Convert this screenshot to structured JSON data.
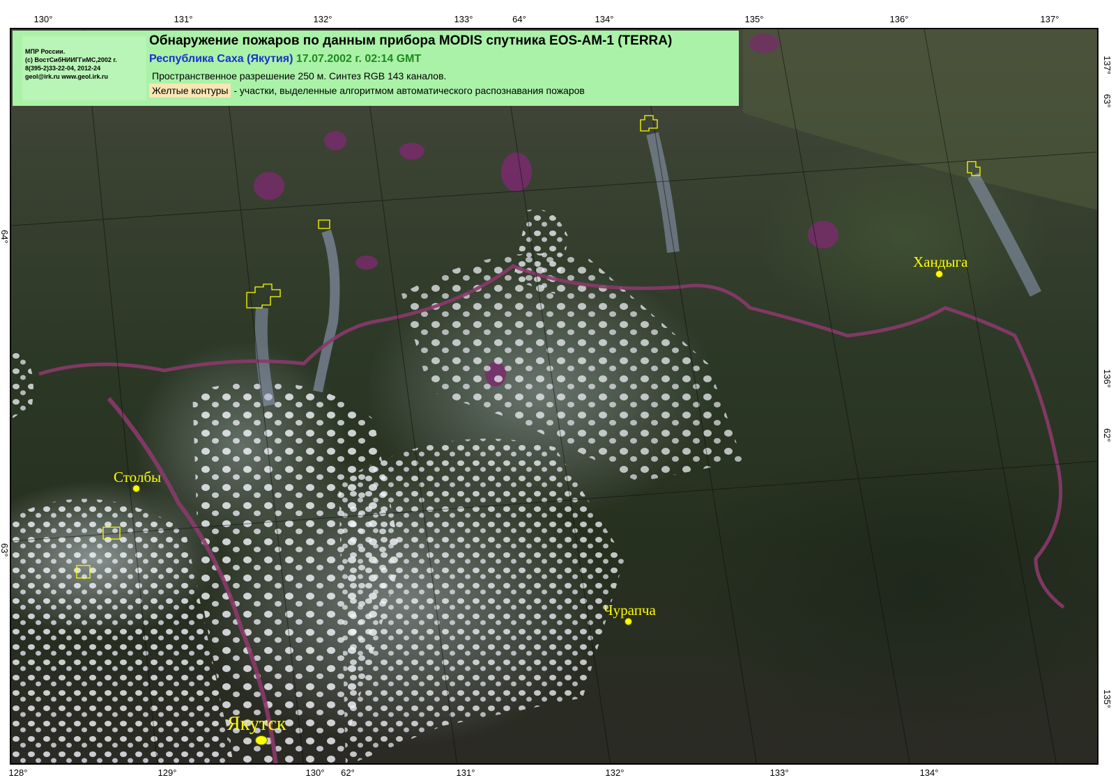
{
  "header": {
    "title": "Обнаружение пожаров по данным прибора MODIS спутника EOS-AM-1 (TERRA)",
    "region": "Республика Саха (Якутия)",
    "datetime": "17.07.2002 г. 02:14 GMT",
    "resolution": "Пространственное разрешение 250 м. Синтез RGB 143 каналов.",
    "legend_swatch_label": "Желтые контуры",
    "legend_text": " - участки, выделенные алгоритмом автоматического распознавания пожаров"
  },
  "credits": [
    "МПР России.",
    "(с) ВостСибНИИГГиМС,2002 г.",
    "8(395-2)33-22-04, 2012-24",
    "geol@irk.ru  www.geol.irk.ru"
  ],
  "ticks": {
    "top": [
      "130°",
      "131°",
      "132°",
      "133°",
      "64°",
      "134°",
      "135°",
      "136°",
      "137°"
    ],
    "bottom": [
      "128°",
      "129°",
      "130°",
      "62°",
      "131°",
      "132°",
      "133°",
      "134°"
    ],
    "left": [
      "64°",
      "63°"
    ],
    "right": [
      "137°",
      "63°",
      "136°",
      "62°",
      "135°"
    ]
  },
  "towns": [
    {
      "name": "Хандыга"
    },
    {
      "name": "Столбы"
    },
    {
      "name": "Чурапча"
    },
    {
      "name": "Якутск"
    }
  ],
  "colors": {
    "header_bg": "#aaf2a8",
    "region_name": "#1a2fd0",
    "region_date": "#1e8a1e",
    "fire_contour": "#ffff00",
    "town_label": "#ffff00",
    "river": "#8a3a6a"
  }
}
